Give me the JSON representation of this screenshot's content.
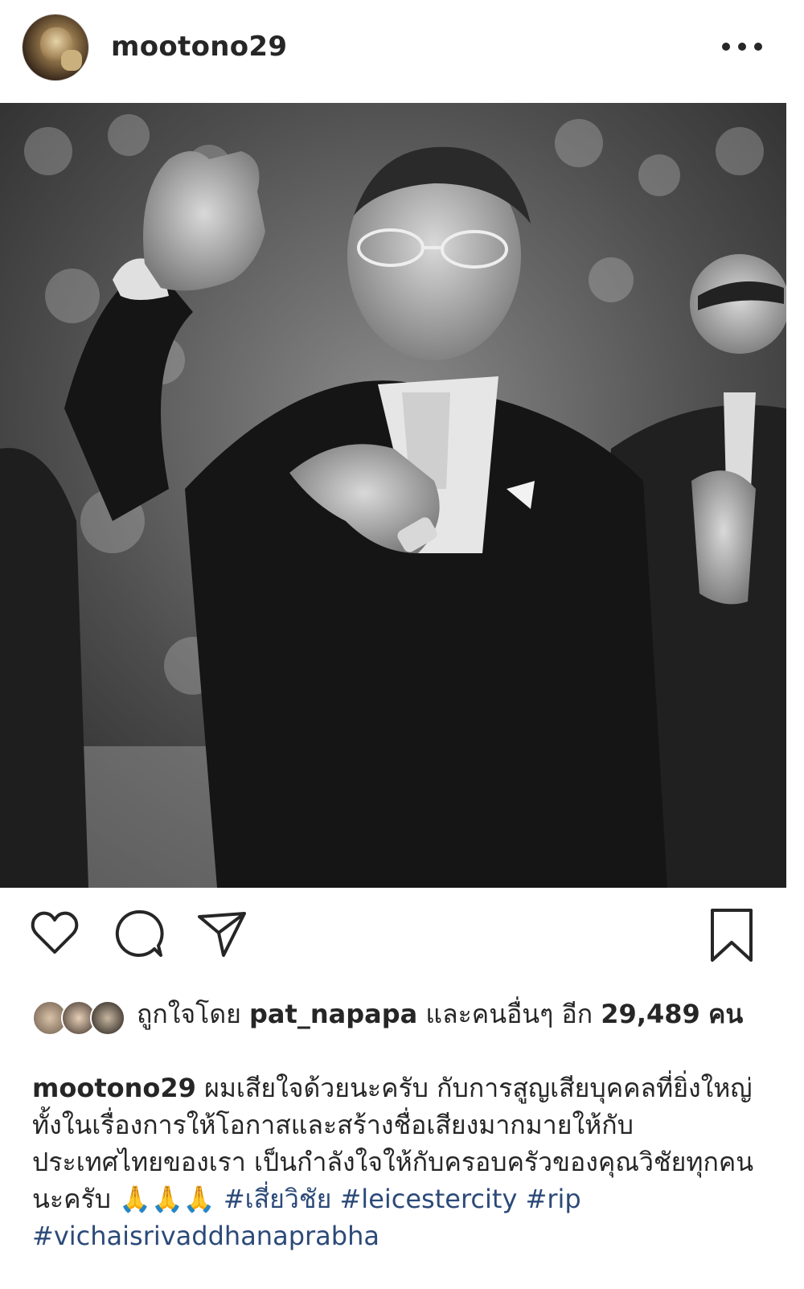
{
  "post": {
    "username": "mootono29",
    "more_icon": "more-horizontal-icon"
  },
  "actions": {
    "like_icon": "heart-icon",
    "comment_icon": "comment-icon",
    "share_icon": "send-icon",
    "save_icon": "bookmark-icon"
  },
  "likes": {
    "prefix": "ถูกใจโดย",
    "user": "pat_napapa",
    "middle": "และคนอื่นๆ อีก",
    "count": "29,489",
    "suffix": "คน"
  },
  "caption": {
    "username": "mootono29",
    "text": "ผมเสียใจด้วยนะครับ กับการสูญเสียบุคคลที่ยิ่งใหญ่ ทั้งในเรื่องการให้โอกาสและสร้างชื่อเสียงมากมายให้กับประเทศไทยของเรา เป็นกำลังใจให้กับครอบครัวของคุณวิชัยทุกคนนะครับ",
    "emoji": "🙏🙏🙏",
    "hashtags": [
      "#เสี่ยวิชัย",
      "#leicestercity",
      "#rip",
      "#vichaisrivaddhanaprabha"
    ]
  },
  "colors": {
    "text": "#262626",
    "hashtag": "#2c4a79"
  }
}
